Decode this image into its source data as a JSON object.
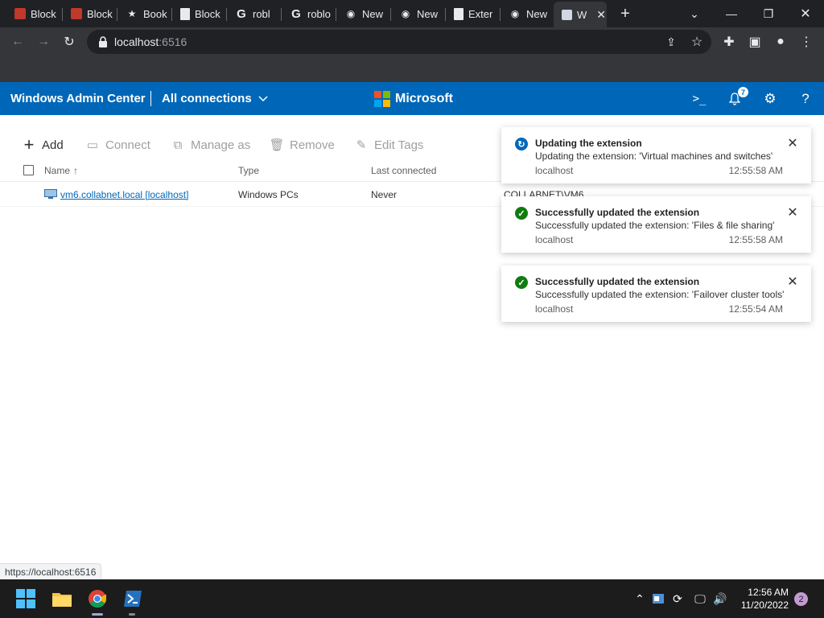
{
  "browser": {
    "tabs": [
      {
        "title": "Block",
        "icon": "roblox-favicon"
      },
      {
        "title": "Block",
        "icon": "roblox-favicon"
      },
      {
        "title": "Book",
        "icon": "star-favicon"
      },
      {
        "title": "Block",
        "icon": "doc-favicon"
      },
      {
        "title": "robl",
        "icon": "google-favicon"
      },
      {
        "title": "roblo",
        "icon": "google-favicon"
      },
      {
        "title": "New",
        "icon": "chrome-favicon"
      },
      {
        "title": "New",
        "icon": "chrome-favicon"
      },
      {
        "title": "Exter",
        "icon": "doc-favicon"
      },
      {
        "title": "New",
        "icon": "chrome-favicon"
      },
      {
        "title": "W",
        "icon": "wac-favicon",
        "active": true
      }
    ],
    "url_host": "localhost",
    "url_port": ":6516",
    "status_url": "https://localhost:6516"
  },
  "wac": {
    "title": "Windows Admin Center",
    "connections_label": "All connections",
    "brand": "Microsoft",
    "notification_count": "7",
    "brand_colors": {
      "header": "#0067b8",
      "ms_red": "#f25022",
      "ms_green": "#7fba00",
      "ms_blue": "#00a4ef",
      "ms_yellow": "#ffb900"
    }
  },
  "commands": {
    "add": "Add",
    "connect": "Connect",
    "manage_as": "Manage as",
    "remove": "Remove",
    "edit_tags": "Edit Tags"
  },
  "table": {
    "columns": {
      "name": "Name",
      "type": "Type",
      "last_connected": "Last connected"
    },
    "rows": [
      {
        "name": "vm6.collabnet.local [localhost]",
        "type": "Windows PCs",
        "last_connected": "Never",
        "managed_as": "COLLABNET\\VM6"
      }
    ]
  },
  "notifications": [
    {
      "status": "in-progress",
      "title": "Updating the extension",
      "message": "Updating the extension: 'Virtual machines and switches'",
      "source": "localhost",
      "time": "12:55:58 AM"
    },
    {
      "status": "success",
      "title": "Successfully updated the extension",
      "message": "Successfully updated the extension: 'Files & file sharing'",
      "source": "localhost",
      "time": "12:55:58 AM"
    },
    {
      "status": "success",
      "title": "Successfully updated the extension",
      "message": "Successfully updated the extension: 'Failover cluster tools'",
      "source": "localhost",
      "time": "12:55:54 AM"
    }
  ],
  "taskbar": {
    "time": "12:56 AM",
    "date": "11/20/2022",
    "notification_count": "2"
  }
}
